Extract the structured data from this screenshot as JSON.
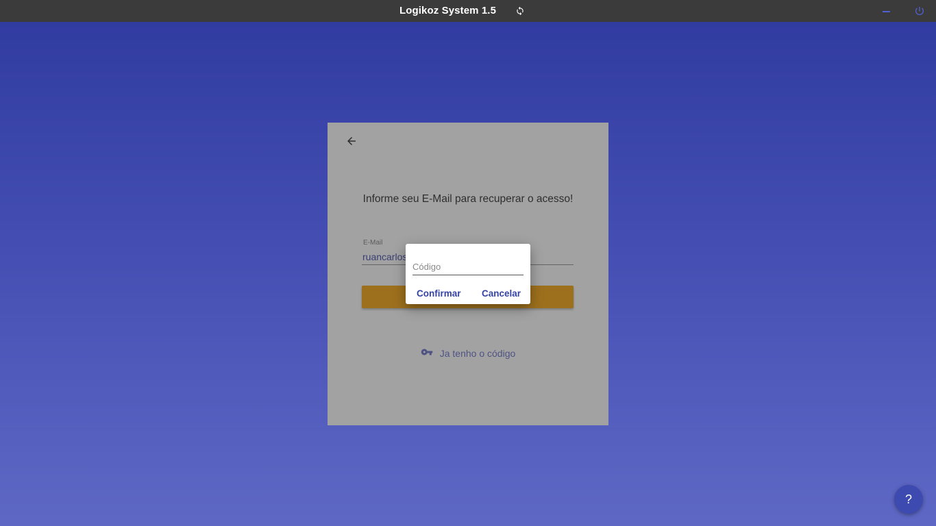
{
  "window": {
    "title": "Logikoz System 1.5",
    "icons": {
      "refresh": "refresh-icon",
      "minimize": "minimize-icon",
      "power": "power-icon"
    }
  },
  "recovery_card": {
    "heading": "Informe seu E-Mail para recuperar o acesso!",
    "email_label": "E-Mail",
    "email_value": "ruancarlos",
    "have_code_label": "Ja tenho o código",
    "icons": {
      "back": "arrow-left-icon",
      "key": "key-icon"
    },
    "colors": {
      "button": "#f5a000",
      "accent": "#3542a6"
    }
  },
  "code_dialog": {
    "placeholder": "Código",
    "confirm_label": "Confirmar",
    "cancel_label": "Cancelar"
  },
  "help_button": {
    "label": "?"
  }
}
